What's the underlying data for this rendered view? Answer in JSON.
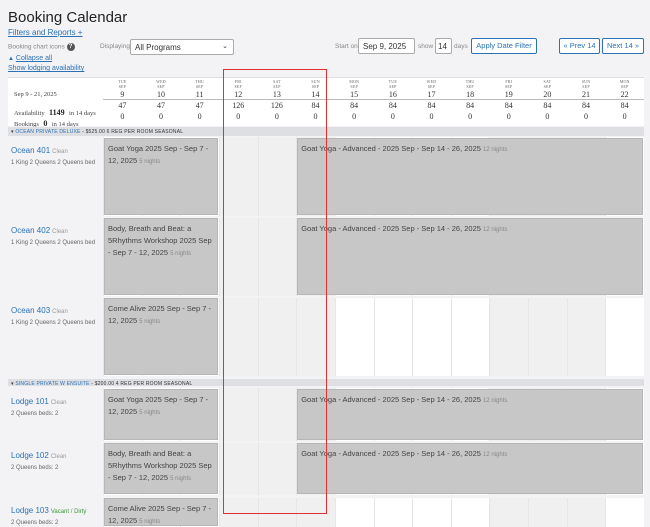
{
  "header": {
    "title": "Booking Calendar",
    "filters_link": "Filters and Reports +",
    "booking_chart_icons": "Booking chart icons",
    "help": "?",
    "displaying_label": "Displaying",
    "program_select": "All Programs",
    "start_on_label": "Start on",
    "start_date": "Sep 9, 2025",
    "show_label": "show",
    "show_days": "14",
    "days_label": "days",
    "apply_button": "Apply Date Filter",
    "prev_button": "« Prev 14",
    "next_button": "Next 14 »",
    "collapse_all": "Collapse all",
    "show_lodging": "Show lodging availability"
  },
  "summary": {
    "date_range": "Sep 9 - 21, 2025",
    "availability_label": "Availability",
    "availability_value": "1149",
    "availability_suffix": "in 14 days",
    "bookings_label": "Bookings",
    "bookings_value": "0",
    "bookings_suffix": "in 14 days"
  },
  "days": [
    {
      "dow": "TUE",
      "mon": "SEP",
      "date": "9",
      "avail": "47",
      "book": "0",
      "weekend": false
    },
    {
      "dow": "WED",
      "mon": "SEP",
      "date": "10",
      "avail": "47",
      "book": "0",
      "weekend": false
    },
    {
      "dow": "THU",
      "mon": "SEP",
      "date": "11",
      "avail": "47",
      "book": "0",
      "weekend": false
    },
    {
      "dow": "FRI",
      "mon": "SEP",
      "date": "12",
      "avail": "126",
      "book": "0",
      "weekend": true
    },
    {
      "dow": "SAT",
      "mon": "SEP",
      "date": "13",
      "avail": "126",
      "book": "0",
      "weekend": true
    },
    {
      "dow": "SUN",
      "mon": "SEP",
      "date": "14",
      "avail": "84",
      "book": "0",
      "weekend": true
    },
    {
      "dow": "MON",
      "mon": "SEP",
      "date": "15",
      "avail": "84",
      "book": "0",
      "weekend": false
    },
    {
      "dow": "TUE",
      "mon": "SEP",
      "date": "16",
      "avail": "84",
      "book": "0",
      "weekend": false
    },
    {
      "dow": "WED",
      "mon": "SEP",
      "date": "17",
      "avail": "84",
      "book": "0",
      "weekend": false
    },
    {
      "dow": "THU",
      "mon": "SEP",
      "date": "18",
      "avail": "84",
      "book": "0",
      "weekend": false
    },
    {
      "dow": "FRI",
      "mon": "SEP",
      "date": "19",
      "avail": "84",
      "book": "0",
      "weekend": true
    },
    {
      "dow": "SAT",
      "mon": "SEP",
      "date": "20",
      "avail": "84",
      "book": "0",
      "weekend": true
    },
    {
      "dow": "SUN",
      "mon": "SEP",
      "date": "21",
      "avail": "84",
      "book": "0",
      "weekend": true
    },
    {
      "dow": "MON",
      "mon": "SEP",
      "date": "22",
      "avail": "84",
      "book": "0",
      "weekend": false
    }
  ],
  "groups": [
    {
      "name": "OCEAN PRIVATE DELUXE",
      "price": "- $525.00",
      "regs": "6 REG PER ROOM",
      "season": "SEASONAL"
    },
    {
      "name": "SINGLE PRIVATE W ENSUITE",
      "price": "- $200.00",
      "regs": "4 REG PER ROOM",
      "season": "SEASONAL"
    }
  ],
  "rooms": [
    {
      "name": "Ocean 401",
      "status": "Clean",
      "beds": "1 King 2 Queens 2 Queens bed",
      "bookings": [
        {
          "text": "Goat Yoga 2025 Sep - Sep 7 - 12, 2025",
          "nights": "5 nights"
        },
        {
          "text": "Goat Yoga - Advanced - 2025 Sep - Sep 14 - 26, 2025",
          "nights": "12 nights"
        }
      ]
    },
    {
      "name": "Ocean 402",
      "status": "Clean",
      "beds": "1 King 2 Queens 2 Queens bed",
      "bookings": [
        {
          "text": "Body, Breath and Beat: a 5Rhythms Workshop 2025 Sep - Sep 7 - 12, 2025",
          "nights": "5 nights"
        },
        {
          "text": "Goat Yoga - Advanced - 2025 Sep - Sep 14 - 26, 2025",
          "nights": "12 nights"
        }
      ]
    },
    {
      "name": "Ocean 403",
      "status": "Clean",
      "beds": "1 King 2 Queens 2 Queens bed",
      "bookings": [
        {
          "text": "Come Alive 2025 Sep - Sep 7 - 12, 2025",
          "nights": "5 nights"
        }
      ]
    },
    {
      "name": "Lodge 101",
      "status": "Clean",
      "beds": "2 Queens beds: 2",
      "bookings": [
        {
          "text": "Goat Yoga 2025 Sep - Sep 7 - 12, 2025",
          "nights": "5 nights"
        },
        {
          "text": "Goat Yoga - Advanced - 2025 Sep - Sep 14 - 26, 2025",
          "nights": "12 nights"
        }
      ]
    },
    {
      "name": "Lodge 102",
      "status": "Clean",
      "beds": "2 Queens beds: 2",
      "bookings": [
        {
          "text": "Body, Breath and Beat: a 5Rhythms Workshop 2025 Sep - Sep 7 - 12, 2025",
          "nights": "5 nights"
        },
        {
          "text": "Goat Yoga - Advanced - 2025 Sep - Sep 14 - 26, 2025",
          "nights": "12 nights"
        }
      ]
    },
    {
      "name": "Lodge 103",
      "status": "Vacant / Dirty",
      "beds": "2 Queens beds: 2",
      "bookings": [
        {
          "text": "Come Alive 2025 Sep - Sep 7 - 12, 2025",
          "nights": "5 nights"
        }
      ]
    }
  ],
  "colors": {
    "link": "#2b72b5",
    "highlight": "#e03030",
    "booking": "#c7c7c7",
    "vacant": "#3a9a3a"
  }
}
